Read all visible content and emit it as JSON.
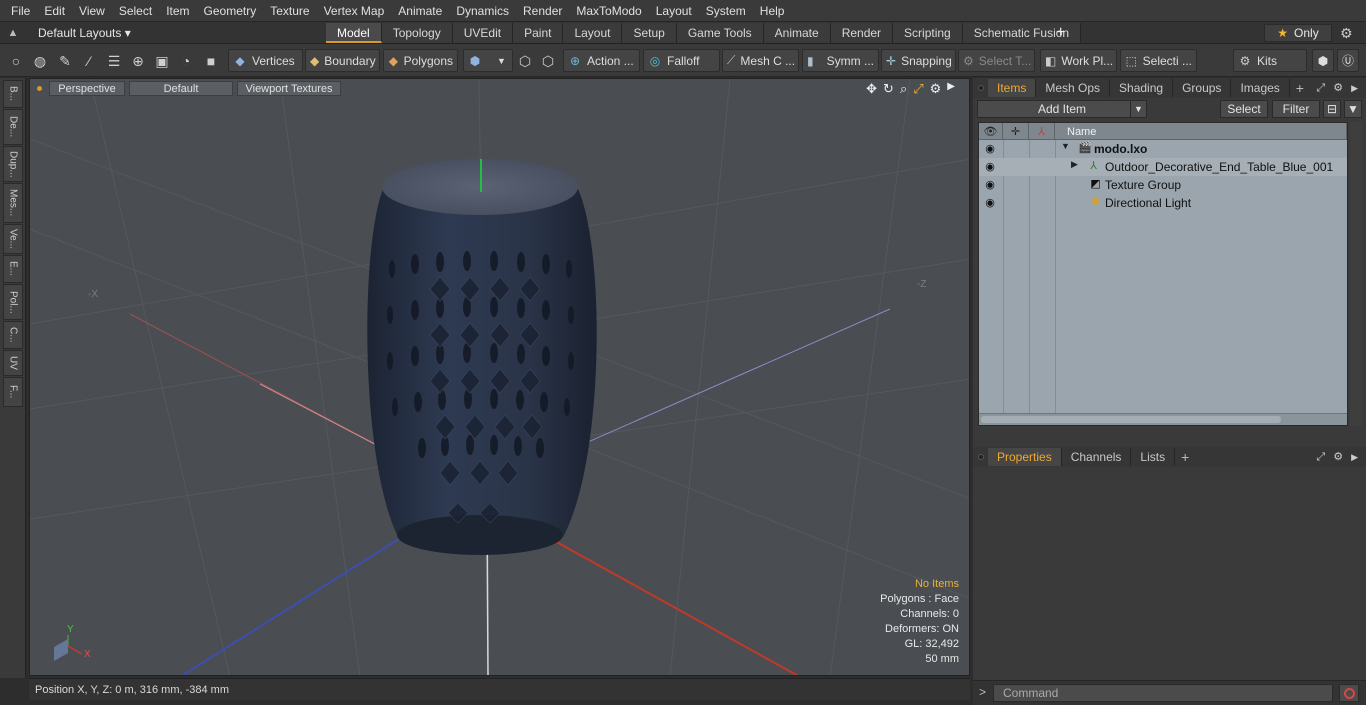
{
  "menu": [
    "File",
    "Edit",
    "View",
    "Select",
    "Item",
    "Geometry",
    "Texture",
    "Vertex Map",
    "Animate",
    "Dynamics",
    "Render",
    "MaxToModo",
    "Layout",
    "System",
    "Help"
  ],
  "layouts": {
    "selector": "Default Layouts ▾",
    "tabs": [
      "Model",
      "Topology",
      "UVEdit",
      "Paint",
      "Layout",
      "Setup",
      "Game Tools",
      "Animate",
      "Render",
      "Scripting",
      "Schematic Fusion"
    ],
    "active_tab": "Model",
    "plus": "+",
    "only_label": "Only",
    "star": "★",
    "gear": "⚙"
  },
  "toolbar": {
    "vertices": "Vertices",
    "boundary": "Boundary",
    "polygons": "Polygons",
    "action": "Action ...",
    "falloff": "Falloff",
    "mesh": "Mesh C ...",
    "symm": "Symm ...",
    "snapping": "Snapping",
    "select_t": "Select T...",
    "work_pl": "Work Pl...",
    "selecti": "Selecti ...",
    "kits": "Kits"
  },
  "left_strip": [
    "B...",
    "De...",
    "Dup...",
    "Mes...",
    "Ve...",
    "E...",
    "Pol...",
    "C...",
    "UV",
    "F..."
  ],
  "viewport": {
    "perspective": "Perspective",
    "default": "Default",
    "textures": "Viewport Textures",
    "axis_x": "-X",
    "axis_z": "-Z",
    "stats": {
      "no_items": "No Items",
      "polygons": "Polygons : Face",
      "channels": "Channels: 0",
      "deformers": "Deformers: ON",
      "gl": "GL: 32,492",
      "size": "50 mm"
    },
    "gizmo_y": "Y",
    "gizmo_x": "X"
  },
  "status": {
    "position": "Position X, Y, Z:   0 m, 316 mm, -384 mm"
  },
  "items_panel": {
    "tabs": [
      "Items",
      "Mesh Ops",
      "Shading",
      "Groups",
      "Images"
    ],
    "active_tab": "Items",
    "plus": "+",
    "add_item": "Add Item",
    "select": "Select",
    "filter": "Filter",
    "col_name": "Name",
    "rows": [
      {
        "label": "modo.lxo",
        "icon": "scene-icon"
      },
      {
        "label": "Outdoor_Decorative_End_Table_Blue_001",
        "icon": "mesh-icon"
      },
      {
        "label": "Texture Group",
        "icon": "texture-group-icon"
      },
      {
        "label": "Directional Light",
        "icon": "light-icon"
      }
    ]
  },
  "props_panel": {
    "tabs": [
      "Properties",
      "Channels",
      "Lists"
    ],
    "active_tab": "Properties",
    "plus": "+"
  },
  "command": {
    "prompt": ">",
    "placeholder": "Command"
  },
  "colors": {
    "accent": "#d89b2a",
    "viewport_bg": "#4a4d52",
    "object": "#2b3548",
    "axis_red": "#c0392b",
    "axis_blue": "#3a4fb0"
  }
}
